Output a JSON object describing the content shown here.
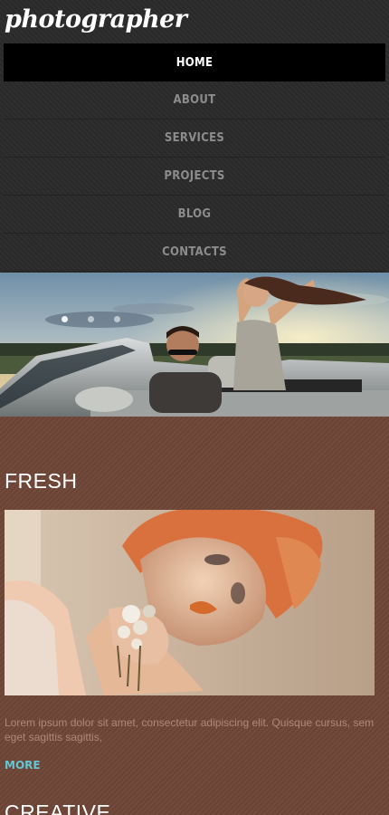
{
  "header": {
    "logo": "photographer"
  },
  "nav": {
    "items": [
      {
        "label": "HOME",
        "active": true
      },
      {
        "label": "ABOUT",
        "active": false
      },
      {
        "label": "SERVICES",
        "active": false
      },
      {
        "label": "PROJECTS",
        "active": false
      },
      {
        "label": "BLOG",
        "active": false
      },
      {
        "label": "CONTACTS",
        "active": false
      }
    ]
  },
  "hero": {
    "slide_count": 3,
    "active_slide": 1
  },
  "content": {
    "section1": {
      "title": "FRESH",
      "text": "Lorem ipsum dolor sit amet, consectetur adipiscing elit. Quisque cursus, sem eget sagittis sagittis,",
      "more_label": "MORE"
    },
    "section2": {
      "title": "CREATIVE"
    }
  },
  "colors": {
    "header_bg": "#2a2a2a",
    "nav_active_bg": "#000000",
    "nav_text": "#8c8c8c",
    "content_bg": "#6e4536",
    "link": "#64c5d4",
    "body_text": "#b08877"
  }
}
